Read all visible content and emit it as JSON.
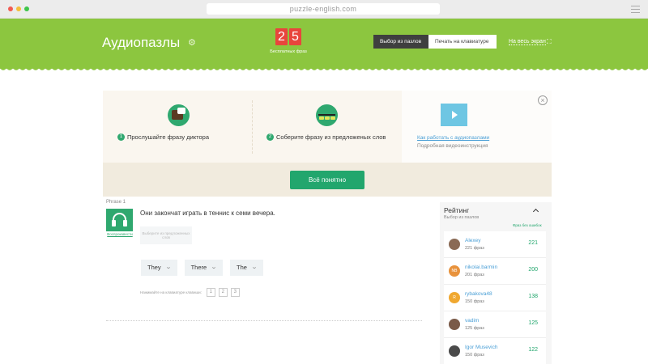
{
  "browser": {
    "url": "puzzle-english.com"
  },
  "header": {
    "title": "Аудиопазлы",
    "counter_digits": [
      "2",
      "5"
    ],
    "counter_label": "Бесплатных фраз",
    "modes": [
      {
        "label": "Выбор из пазлов",
        "active": true
      },
      {
        "label": "Печать на клавиатуре",
        "active": false
      }
    ],
    "fullscreen_label": "На весь экран"
  },
  "intro": {
    "step1": {
      "num": "1",
      "text": "Прослушайте фразу диктора"
    },
    "step2": {
      "num": "2",
      "text": "Соберите фразу из предложеных слов"
    },
    "howto_link": "Как работать с аудиопазлами",
    "howto_sub": "Подробная видеоинструкция",
    "confirm_button": "Всё понятно"
  },
  "exercise": {
    "phrase_label": "Phrase 1",
    "play_label": "Воспроизвести",
    "sentence": "Они закончат играть в теннис к семи вечера.",
    "answer_placeholder": "Выберите из предложенных слов",
    "words": [
      "They",
      "There",
      "The"
    ],
    "hint_text": "Нажимайте на клавиатуре клавиши:",
    "hint_keys": [
      "1",
      "2",
      "3"
    ]
  },
  "rating": {
    "title": "Рейтинг",
    "subtitle": "Выбор из пазлов",
    "column_label": "Фраз без ошибок",
    "items": [
      {
        "name": "Alexey",
        "phrases": "221 фраз",
        "score": "221",
        "initials": "",
        "avatar_color": "#8a6a55"
      },
      {
        "name": "nikolai.barmin",
        "phrases": "201 фраз",
        "score": "200",
        "initials": "NB",
        "avatar_color": "#e8923c"
      },
      {
        "name": "rybakova48",
        "phrases": "150 фраз",
        "score": "138",
        "initials": "R",
        "avatar_color": "#f0a830"
      },
      {
        "name": "vadim",
        "phrases": "125 фраз",
        "score": "125",
        "initials": "",
        "avatar_color": "#7a5a48"
      },
      {
        "name": "Igor Musevich",
        "phrases": "150 фраз",
        "score": "122",
        "initials": "",
        "avatar_color": "#4a4a4a"
      }
    ]
  }
}
